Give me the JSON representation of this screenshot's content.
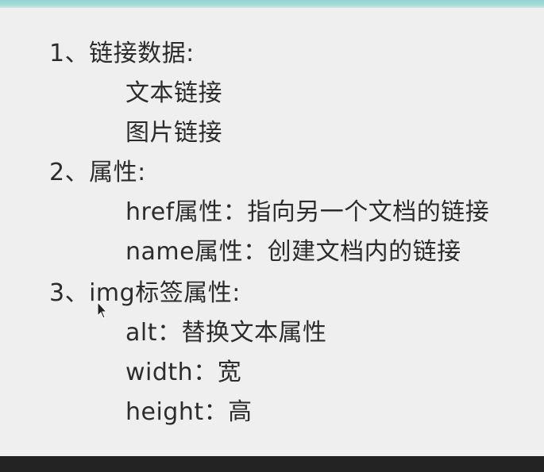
{
  "slide": {
    "lines": [
      "1、链接数据:",
      "文本链接",
      "图片链接",
      "2、属性:",
      "href属性：指向另一个文档的链接",
      "name属性：创建文档内的链接",
      "3、img标签属性:",
      "alt：替换文本属性",
      "width：宽",
      "height：高"
    ]
  },
  "colors": {
    "top_bar": "#a9dcd9",
    "slide_background": "#efefef",
    "text": "#2c2c2c"
  },
  "icons": {
    "cursor": "arrow-cursor-icon"
  }
}
